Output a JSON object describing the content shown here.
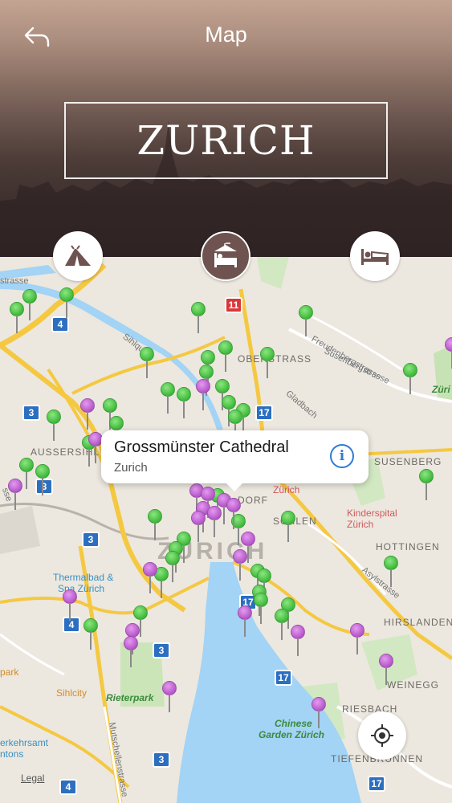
{
  "header": {
    "nav_title": "Map",
    "city": "ZURICH"
  },
  "icons": {
    "back": "back-arrow-icon",
    "tent": "tent-icon",
    "attractions": "sightseeing-icon",
    "hotel": "bed-icon",
    "locate": "locate-crosshair-icon"
  },
  "colors": {
    "header_dark": "#35292a",
    "active_category": "#6f5350",
    "green_pin": "#3fb83c",
    "purple_pin": "#b456c8",
    "highway": "#f5c842",
    "water": "#a3d3f5",
    "shield_blue": "#2c6fc0"
  },
  "map": {
    "labels": {
      "strasse_top": "strasse",
      "sihlquai": "Sihlquai",
      "oberstrass": "OBERSTRASS",
      "freudenbergstrasse": "Freudenbergstrasse",
      "susenbergstrasse": "Susenbergstrasse",
      "gladbach": "Gladbach",
      "aussersihl": "AUSSERSIHL",
      "susenberg": "SUSENBERG",
      "zurich_poi": "Zürich",
      "dorf": "DORF",
      "schlen": "SCHLEN",
      "kinderspital": "Kinderspital",
      "kinderspital_2": "Zürich",
      "zurich_big": "ZURICH",
      "hottingen": "HOTTINGEN",
      "thermalbad": "Thermalbad &",
      "thermalbad_2": "Spa Zürich",
      "asylstrasse": "Asylstrasse",
      "hirslanden": "HIRSLANDEN",
      "park": "park",
      "sihlcity": "Sihlcity",
      "weinegg": "WEINEGG",
      "rieterpark": "Rieterpark",
      "riesbach": "RIESBACH",
      "chinese_garden": "Chinese",
      "chinese_garden_2": "Garden Zürich",
      "verkehrsamt": "erkehrsamt",
      "kantons": "ntons",
      "tiefenbrunnen": "TIEFENBRUNNEN",
      "mutschellenstrasse": "Mutschellenstrasse",
      "zuri": "Züri",
      "ssestr": "sse"
    },
    "shields": [
      "4",
      "3",
      "17",
      "3",
      "3",
      "17",
      "4",
      "3",
      "17",
      "3",
      "4",
      "17",
      "11"
    ],
    "legal": "Legal"
  },
  "callout": {
    "title": "Grossmünster Cathedral",
    "subtitle": "Zurich",
    "info_symbol": "i"
  }
}
